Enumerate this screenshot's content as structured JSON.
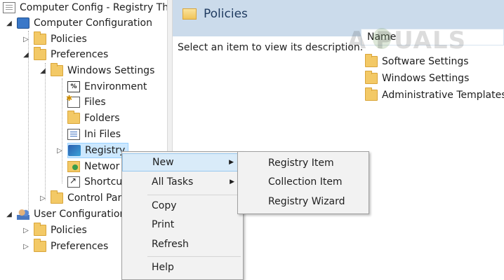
{
  "tree": {
    "root": {
      "label": "Computer Config - Registry The",
      "icon": "policy-doc-icon"
    },
    "computer_config": {
      "label": "Computer Configuration",
      "icon": "computer-icon"
    },
    "policies": {
      "label": "Policies"
    },
    "preferences": {
      "label": "Preferences"
    },
    "windows_settings": {
      "label": "Windows Settings"
    },
    "environment": {
      "label": "Environment"
    },
    "files": {
      "label": "Files"
    },
    "folders": {
      "label": "Folders"
    },
    "ini_files": {
      "label": "Ini Files"
    },
    "registry": {
      "label": "Registry"
    },
    "network": {
      "label": "Networ"
    },
    "shortcuts": {
      "label": "Shortcu"
    },
    "control_panel": {
      "label": "Control Par"
    },
    "user_config": {
      "label": "User Configuration",
      "icon": "users-icon"
    },
    "user_policies": {
      "label": "Policies"
    },
    "user_preferences": {
      "label": "Preferences"
    }
  },
  "right_pane": {
    "header_title": "Policies",
    "description": "Select an item to view its description.",
    "column_header": "Name",
    "items": [
      {
        "label": "Software Settings"
      },
      {
        "label": "Windows Settings"
      },
      {
        "label": "Administrative Templates"
      }
    ],
    "watermark": "A PUALS"
  },
  "context_menu": {
    "items": [
      {
        "label": "New",
        "has_submenu": true,
        "highlighted": true
      },
      {
        "label": "All Tasks",
        "has_submenu": true
      },
      {
        "label": "Copy"
      },
      {
        "label": "Print"
      },
      {
        "label": "Refresh"
      },
      {
        "label": "Help"
      }
    ]
  },
  "submenu": {
    "items": [
      {
        "label": "Registry Item"
      },
      {
        "label": "Collection Item"
      },
      {
        "label": "Registry Wizard"
      }
    ]
  },
  "colors": {
    "header_bg": "#cbdbeb",
    "menu_bg": "#f2f2f2",
    "highlight": "#d9ebf9",
    "selection": "#cce8ff"
  }
}
